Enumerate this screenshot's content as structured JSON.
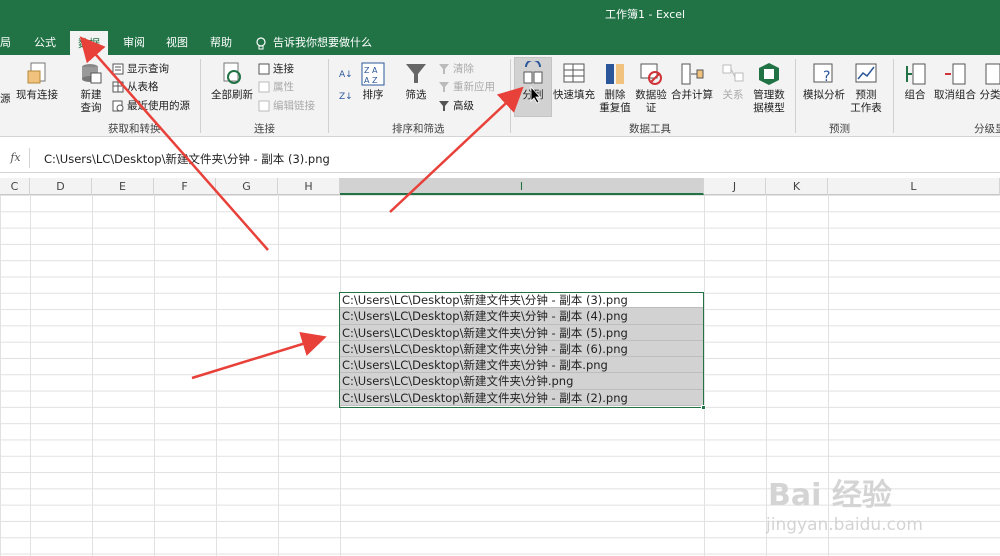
{
  "window": {
    "title": "工作簿1  -  Excel"
  },
  "tabs": [
    {
      "label": "局"
    },
    {
      "label": "公式"
    },
    {
      "label": "数据"
    },
    {
      "label": "审阅"
    },
    {
      "label": "视图"
    },
    {
      "label": "帮助"
    }
  ],
  "tell_me": "告诉我你想要做什么",
  "ribbon": {
    "group_get": {
      "label": "获取和转换",
      "source_cut": "源",
      "existing_conn": "现有连接",
      "new_query_l1": "新建",
      "new_query_l2": "查询",
      "show_queries": "显示查询",
      "from_table": "从表格",
      "recent_sources": "最近使用的源"
    },
    "group_conn": {
      "label": "连接",
      "refresh_all": "全部刷新",
      "connections": "连接",
      "properties": "属性",
      "edit_links": "编辑链接"
    },
    "group_sort": {
      "label": "排序和筛选",
      "sort": "排序",
      "filter": "筛选",
      "clear": "清除",
      "reapply": "重新应用",
      "advanced": "高级"
    },
    "group_tools": {
      "label": "数据工具",
      "split": "分列",
      "flash_fill": "快速填充",
      "remove_dup_l1": "删除",
      "remove_dup_l2": "重复值",
      "validation_l1": "数据验",
      "validation_l2": "证",
      "consolidate": "合并计算",
      "relations": "关系",
      "data_model_l1": "管理数",
      "data_model_l2": "据模型"
    },
    "group_forecast": {
      "label": "预测",
      "what_if": "模拟分析",
      "forecast_l1": "预测",
      "forecast_l2": "工作表"
    },
    "group_outline": {
      "label": "分级显",
      "group": "组合",
      "ungroup": "取消组合",
      "subtotal": "分类"
    }
  },
  "formula_bar": {
    "fx": "fx",
    "value": "C:\\Users\\LC\\Desktop\\新建文件夹\\分钟 - 副本 (3).png"
  },
  "columns": [
    "C",
    "D",
    "E",
    "F",
    "G",
    "H",
    "I",
    "J",
    "K",
    "L"
  ],
  "cells": [
    "C:\\Users\\LC\\Desktop\\新建文件夹\\分钟 - 副本 (3).png",
    "C:\\Users\\LC\\Desktop\\新建文件夹\\分钟 - 副本 (4).png",
    "C:\\Users\\LC\\Desktop\\新建文件夹\\分钟 - 副本 (5).png",
    "C:\\Users\\LC\\Desktop\\新建文件夹\\分钟 - 副本 (6).png",
    "C:\\Users\\LC\\Desktop\\新建文件夹\\分钟 - 副本.png",
    "C:\\Users\\LC\\Desktop\\新建文件夹\\分钟.png",
    "C:\\Users\\LC\\Desktop\\新建文件夹\\分钟 - 副本 (2).png"
  ],
  "watermark": {
    "line1": "Bai 经验",
    "line2": "jingyan.baidu.com"
  },
  "colors": {
    "excel_green": "#217346",
    "arrow_red": "#e8413a"
  }
}
